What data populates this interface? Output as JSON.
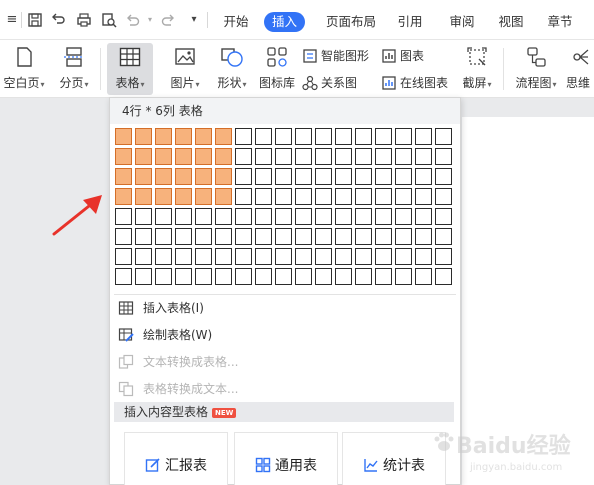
{
  "menu": {
    "tabs": [
      "开始",
      "插入",
      "页面布局",
      "引用",
      "审阅",
      "视图",
      "章节"
    ],
    "active_tab": "插入"
  },
  "ribbon": {
    "blank_page": "空白页",
    "page_break": "分页",
    "table": "表格",
    "picture": "图片",
    "shape": "形状",
    "icon_library": "图标库",
    "smart_shape": "智能图形",
    "chart": "图表",
    "relation_chart": "关系图",
    "online_chart": "在线图表",
    "screenshot": "截屏",
    "flowchart": "流程图",
    "mind_map": "思维"
  },
  "panel": {
    "header": "4行 * 6列 表格",
    "grid_rows": 8,
    "grid_cols": 17,
    "selected_rows": 4,
    "selected_cols": 6,
    "items": {
      "insert_table": "插入表格(I)",
      "draw_table": "绘制表格(W)",
      "text_to_table": "文本转换成表格...",
      "table_to_text": "表格转换成文本..."
    },
    "section_title": "插入内容型表格",
    "badge": "NEW",
    "cards": {
      "report": "汇报表",
      "general": "通用表",
      "stats": "统计表"
    }
  },
  "watermark": {
    "main": "Baidu经验",
    "sub": "jingyan.baidu.com"
  },
  "colors": {
    "accent": "#3273f6",
    "cell_selected": "#f7b27c",
    "arrow": "#e8322a",
    "badge": "#ef5040"
  }
}
